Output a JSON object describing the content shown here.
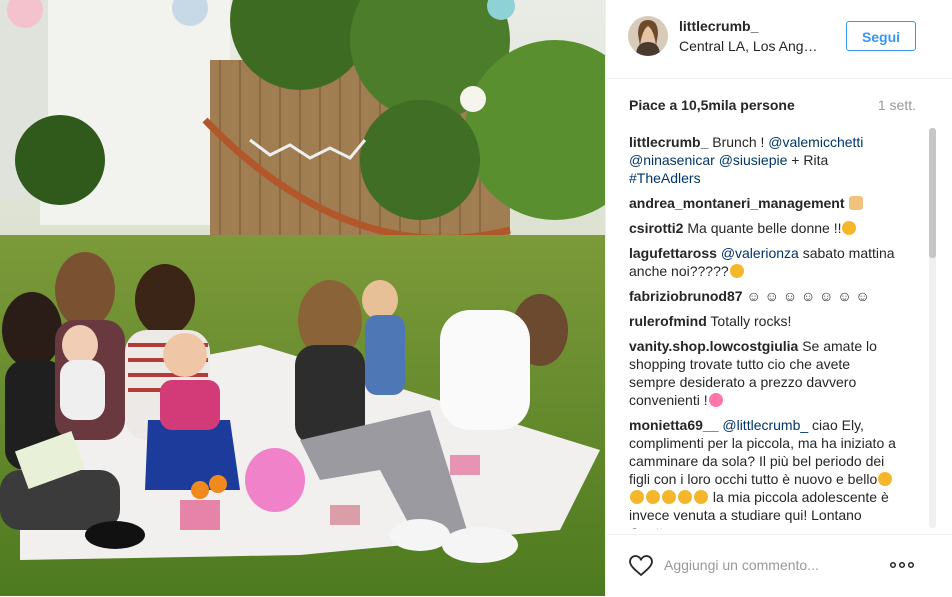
{
  "post": {
    "username": "littlecrumb_",
    "location": "Central LA, Los Ang…",
    "follow_label": "Segui",
    "likes": "Piace a 10,5mila persone",
    "time": "1 sett.",
    "comments": [
      {
        "user": "littlecrumb_",
        "parts": [
          {
            "t": "text",
            "v": " Brunch ! "
          },
          {
            "t": "mention",
            "v": "@valemicchetti"
          },
          {
            "t": "text",
            "v": " "
          },
          {
            "t": "mention",
            "v": "@ninasenicar"
          },
          {
            "t": "text",
            "v": " "
          },
          {
            "t": "mention",
            "v": "@siusiepie"
          },
          {
            "t": "text",
            "v": " + Rita "
          },
          {
            "t": "mention",
            "v": "#TheAdlers"
          }
        ]
      },
      {
        "user": "andrea_montaneri_management",
        "parts": [
          {
            "t": "text",
            "v": " "
          },
          {
            "t": "emoji",
            "v": "hand"
          }
        ]
      },
      {
        "user": "csirotti2",
        "parts": [
          {
            "t": "text",
            "v": " Ma quante belle donne !!"
          },
          {
            "t": "emoji",
            "v": "face"
          }
        ]
      },
      {
        "user": "lagufettaross",
        "parts": [
          {
            "t": "text",
            "v": " "
          },
          {
            "t": "mention",
            "v": "@valerionza"
          },
          {
            "t": "text",
            "v": " sabato mattina anche noi?????"
          },
          {
            "t": "emoji",
            "v": "face"
          }
        ]
      },
      {
        "user": "fabriziobrunod87",
        "parts": [
          {
            "t": "text",
            "v": " ☺ ☺ ☺ ☺ ☺ ☺ ☺"
          }
        ]
      },
      {
        "user": "rulerofmind",
        "parts": [
          {
            "t": "text",
            "v": " Totally rocks!"
          }
        ]
      },
      {
        "user": "vanity.shop.lowcostgiulia",
        "parts": [
          {
            "t": "text",
            "v": " Se amate lo shopping trovate tutto cio che avete sempre desiderato a prezzo davvero convenienti !"
          },
          {
            "t": "emoji",
            "v": "heart"
          }
        ]
      },
      {
        "user": "monietta69__",
        "parts": [
          {
            "t": "text",
            "v": " "
          },
          {
            "t": "mention",
            "v": "@littlecrumb_"
          },
          {
            "t": "text",
            "v": " ciao Ely, complimenti per la piccola, ma ha iniziato a camminare da sola? Il più bel periodo dei figli con i loro occhi tutto è nuovo e bello"
          },
          {
            "t": "emoji",
            "v": "face"
          },
          {
            "t": "emoji",
            "v": "face"
          },
          {
            "t": "emoji",
            "v": "face"
          },
          {
            "t": "emoji",
            "v": "face"
          },
          {
            "t": "emoji",
            "v": "face"
          },
          {
            "t": "emoji",
            "v": "face"
          },
          {
            "t": "text",
            "v": " la mia piccola adolescente è invece venuta a studiare qui! Lontano Quattro..."
          }
        ]
      }
    ],
    "add_comment_placeholder": "Aggiungi un commento..."
  }
}
